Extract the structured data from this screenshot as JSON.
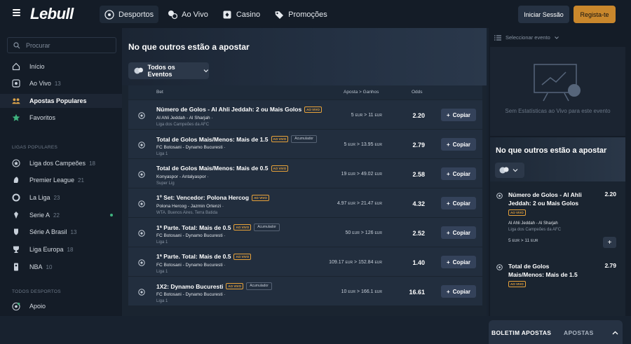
{
  "brand": {
    "logo": "Lebull"
  },
  "nav": [
    {
      "label": "Desportos",
      "icon": "soccer-ball-icon",
      "active": true
    },
    {
      "label": "Ao Vivo",
      "icon": "live-icon"
    },
    {
      "label": "Casino",
      "icon": "casino-icon"
    },
    {
      "label": "Promoções",
      "icon": "tag-icon"
    }
  ],
  "auth": {
    "login": "Iniciar Sessão",
    "register": "Regista-te"
  },
  "colors": {
    "accent": "#c9872c",
    "live": "#e7a23a"
  },
  "sidebar": {
    "search_placeholder": "Procurar",
    "items": [
      {
        "label": "Início",
        "icon": "home-icon",
        "count": ""
      },
      {
        "label": "Ao Vivo",
        "icon": "live-icon",
        "count": "13"
      },
      {
        "label": "Apostas Populares",
        "icon": "people-icon",
        "count": ""
      },
      {
        "label": "Favoritos",
        "icon": "star-icon",
        "count": ""
      }
    ],
    "leagues_title": "LIGAS POPULARES",
    "leagues": [
      {
        "label": "Liga dos Campeões",
        "count": "18"
      },
      {
        "label": "Premier League",
        "count": "21"
      },
      {
        "label": "La Liga",
        "count": "23"
      },
      {
        "label": "Serie A",
        "count": "22"
      },
      {
        "label": "Série A Brasil",
        "count": "13"
      },
      {
        "label": "Liga Europa",
        "count": "18"
      },
      {
        "label": "NBA",
        "count": "10"
      }
    ],
    "all_sports_title": "TODOS DESPORTOS",
    "support": "Apoio"
  },
  "main": {
    "title": "No que outros estão a apostar",
    "filter": "Todos os Eventos",
    "columns": {
      "bet": "Bet",
      "stake": "Aposta > Ganhos",
      "odds": "Odds"
    },
    "live_badge": "AO VIVO",
    "acc_badge": "Acumulador",
    "copy_label": "Copiar",
    "rows": [
      {
        "title": "Número de Golos - Al Ahli Jeddah: 2 ou Mais Golos",
        "acc": false,
        "teams": "Al Ahli Jeddah - Al Sharjah",
        "league": "Liga dos Campeões da AFC",
        "stake": "5",
        "win": "11",
        "odds": "2.20"
      },
      {
        "title": "Total de Golos Mais/Menos: Mais de 1.5",
        "acc": true,
        "teams": "FC Botosani - Dynamo Bucuresti",
        "league": "Liga 1",
        "stake": "5",
        "win": "13.95",
        "odds": "2.79"
      },
      {
        "title": "Total de Golos Mais/Menos: Mais de 0.5",
        "acc": false,
        "teams": "Konyaspor - Antalyaspor",
        "league": "Super Lig",
        "stake": "19",
        "win": "49.02",
        "odds": "2.58"
      },
      {
        "title": "1º Set: Vencedor: Polona Hercog",
        "acc": false,
        "teams": "Polona Hercog - Jazmin Ortenzi",
        "league": "WTA. Buenos Aires. Terra Batida",
        "stake": "4.97",
        "win": "21.47",
        "odds": "4.32"
      },
      {
        "title": "1ª Parte. Total: Mais de 0.5",
        "acc": true,
        "teams": "FC Botosani - Dynamo Bucuresti",
        "league": "Liga 1",
        "stake": "50",
        "win": "126",
        "odds": "2.52"
      },
      {
        "title": "1ª Parte. Total: Mais de 0.5",
        "acc": false,
        "teams": "FC Botosani - Dynamo Bucuresti",
        "league": "Liga 1",
        "stake": "109.17",
        "win": "152.84",
        "odds": "1.40"
      },
      {
        "title": "1X2: Dynamo Bucuresti",
        "acc": true,
        "teams": "FC Botosani - Dynamo Bucuresti",
        "league": "Liga 1",
        "stake": "10",
        "win": "166.1",
        "odds": "16.61"
      }
    ],
    "currency": "EUR"
  },
  "right": {
    "select_event": "Seleccionar evento",
    "no_stats": "Sem Estatísticas ao Vivo para este evento",
    "title": "No que outros estão a apostar",
    "bets": [
      {
        "title": "Número de Golos - Al Ahli Jeddah: 2 ou Mais Golos",
        "teams": "Al Ahli Jeddah - Al Sharjah",
        "league": "Liga dos Campeões da AFC",
        "stake": "5",
        "win": "11",
        "odds": "2.20"
      },
      {
        "title": "Total de Golos Mais/Menos: Mais de 1.5",
        "odds": "2.79"
      }
    ],
    "betslip": {
      "tab1": "BOLETIM APOSTAS",
      "tab2": "APOSTAS"
    }
  }
}
